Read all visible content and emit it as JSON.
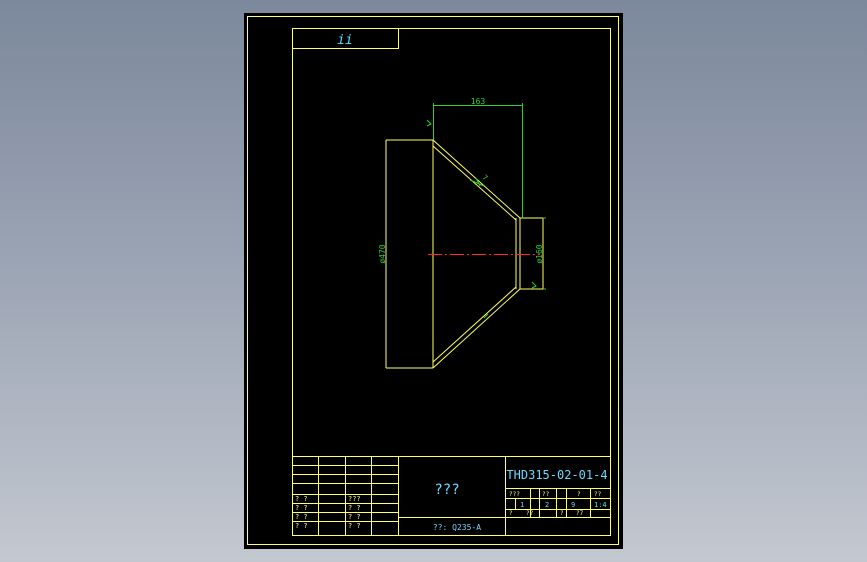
{
  "colors": {
    "background_gradient_top": "#7c889c",
    "background_gradient_bottom": "#c3c8d0",
    "sheet": "#000000",
    "border_lines": "#ffff66",
    "dimension_lines": "#2fd12f",
    "centerline": "#ff2a2a",
    "text_yellow": "#ffff88",
    "text_cyan": "#6fd8ff",
    "text_white": "#ffffff"
  },
  "header_box": {
    "label": "ii"
  },
  "part": {
    "shape": "truncated-cone reducer"
  },
  "dimensions": {
    "top_width": "163",
    "large_diameter": "ø470",
    "small_diameter": "ø160",
    "slant_mark": "7"
  },
  "title_block": {
    "drawing_title": "???",
    "drawing_number": "THD315-02-01-4",
    "material": "??: Q235-A",
    "left_labels": [
      "? ?",
      "? ?",
      "? ?",
      "? ?"
    ],
    "mid_labels": [
      "???",
      "? ?",
      "? ?",
      "? ?"
    ],
    "info_headers": [
      "???",
      "??",
      "?",
      "??"
    ],
    "info_values": [
      "1",
      "2",
      "9",
      "1:4"
    ],
    "info_bottom": [
      "?",
      "??",
      "?",
      "?7"
    ]
  }
}
